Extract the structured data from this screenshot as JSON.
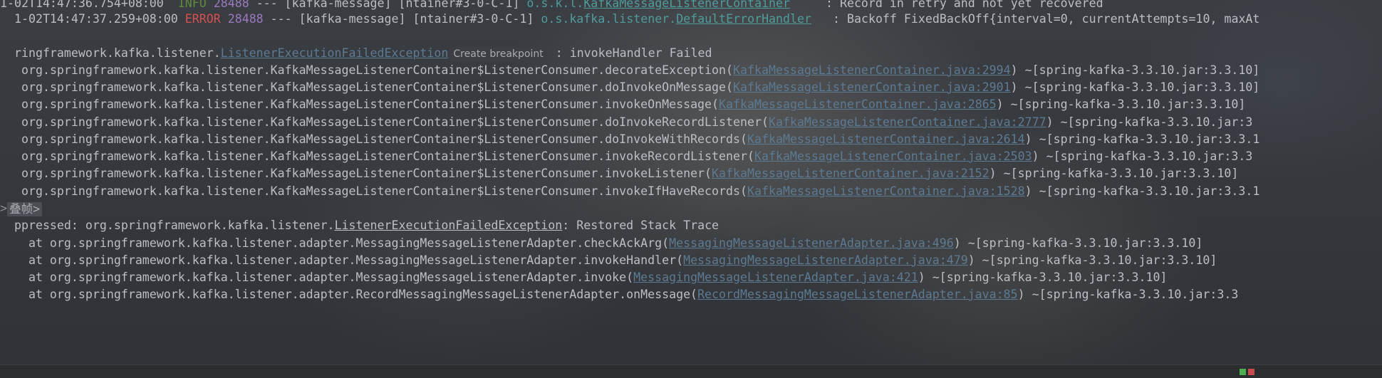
{
  "header_lines": [
    {
      "ts": "1-02T14:47:36.754+08:00",
      "level": "INFO",
      "pid": "28488",
      "sep": "---",
      "app": "[kafka-message]",
      "thread": "[ntainer#3-0-C-1]",
      "logger_prefix": "o.s.k.l.",
      "logger_link": "KafkaMessageListenerContainer",
      "message": ": Record in retry and not yet recovered"
    },
    {
      "ts": "1-02T14:47:37.259+08:00",
      "level": "ERROR",
      "pid": "28488",
      "sep": "---",
      "app": "[kafka-message]",
      "thread": "[ntainer#3-0-C-1]",
      "logger_prefix": "o.s.kafka.listener.",
      "logger_link": "DefaultErrorHandler",
      "message": ": Backoff FixedBackOff{interval=0, currentAttempts=10, maxAt"
    }
  ],
  "exception_line": {
    "prefix": "ringframework.kafka.listener.",
    "link": "ListenerExecutionFailedException",
    "hint": "Create breakpoint",
    "message": ": invokeHandler Failed"
  },
  "stack_frames_1": [
    {
      "method": "org.springframework.kafka.listener.KafkaMessageListenerContainer$ListenerConsumer.decorateException(",
      "link": "KafkaMessageListenerContainer.java:2994",
      "suffix": ") ~[spring-kafka-3.3.10.jar:3.3.10]"
    },
    {
      "method": "org.springframework.kafka.listener.KafkaMessageListenerContainer$ListenerConsumer.doInvokeOnMessage(",
      "link": "KafkaMessageListenerContainer.java:2901",
      "suffix": ") ~[spring-kafka-3.3.10.jar:3.3.10]"
    },
    {
      "method": "org.springframework.kafka.listener.KafkaMessageListenerContainer$ListenerConsumer.invokeOnMessage(",
      "link": "KafkaMessageListenerContainer.java:2865",
      "suffix": ") ~[spring-kafka-3.3.10.jar:3.3.10]"
    },
    {
      "method": "org.springframework.kafka.listener.KafkaMessageListenerContainer$ListenerConsumer.doInvokeRecordListener(",
      "link": "KafkaMessageListenerContainer.java:2777",
      "suffix": ") ~[spring-kafka-3.3.10.jar:3"
    },
    {
      "method": "org.springframework.kafka.listener.KafkaMessageListenerContainer$ListenerConsumer.doInvokeWithRecords(",
      "link": "KafkaMessageListenerContainer.java:2614",
      "suffix": ") ~[spring-kafka-3.3.10.jar:3.3.1"
    },
    {
      "method": "org.springframework.kafka.listener.KafkaMessageListenerContainer$ListenerConsumer.invokeRecordListener(",
      "link": "KafkaMessageListenerContainer.java:2503",
      "suffix": ") ~[spring-kafka-3.3.10.jar:3.3"
    },
    {
      "method": "org.springframework.kafka.listener.KafkaMessageListenerContainer$ListenerConsumer.invokeListener(",
      "link": "KafkaMessageListenerContainer.java:2152",
      "suffix": ") ~[spring-kafka-3.3.10.jar:3.3.10]"
    },
    {
      "method": "org.springframework.kafka.listener.KafkaMessageListenerContainer$ListenerConsumer.invokeIfHaveRecords(",
      "link": "KafkaMessageListenerContainer.java:1528",
      "suffix": ") ~[spring-kafka-3.3.10.jar:3.3.1"
    }
  ],
  "fold": {
    "arrow": ">",
    "label": "叠帧>"
  },
  "suppressed_line": {
    "prefix": "ppressed: org.springframework.kafka.listener.",
    "link": "ListenerExecutionFailedException",
    "message": ": Restored Stack Trace"
  },
  "stack_frames_2": [
    {
      "method": "  at org.springframework.kafka.listener.adapter.MessagingMessageListenerAdapter.checkAckArg(",
      "link": "MessagingMessageListenerAdapter.java:496",
      "suffix": ") ~[spring-kafka-3.3.10.jar:3.3.10]"
    },
    {
      "method": "  at org.springframework.kafka.listener.adapter.MessagingMessageListenerAdapter.invokeHandler(",
      "link": "MessagingMessageListenerAdapter.java:479",
      "suffix": ") ~[spring-kafka-3.3.10.jar:3.3.10]"
    },
    {
      "method": "  at org.springframework.kafka.listener.adapter.MessagingMessageListenerAdapter.invoke(",
      "link": "MessagingMessageListenerAdapter.java:421",
      "suffix": ") ~[spring-kafka-3.3.10.jar:3.3.10]"
    },
    {
      "method": "  at org.springframework.kafka.listener.adapter.RecordMessagingMessageListenerAdapter.onMessage(",
      "link": "RecordMessagingMessageListenerAdapter.java:85",
      "suffix": ") ~[spring-kafka-3.3.10.jar:3.3"
    }
  ],
  "colors": {
    "link": "#5d7a93",
    "info": "#5e8d3a",
    "error": "#d6514f",
    "pid": "#9b7abf",
    "logger": "#4f9c9c",
    "text": "#bcbec4"
  }
}
